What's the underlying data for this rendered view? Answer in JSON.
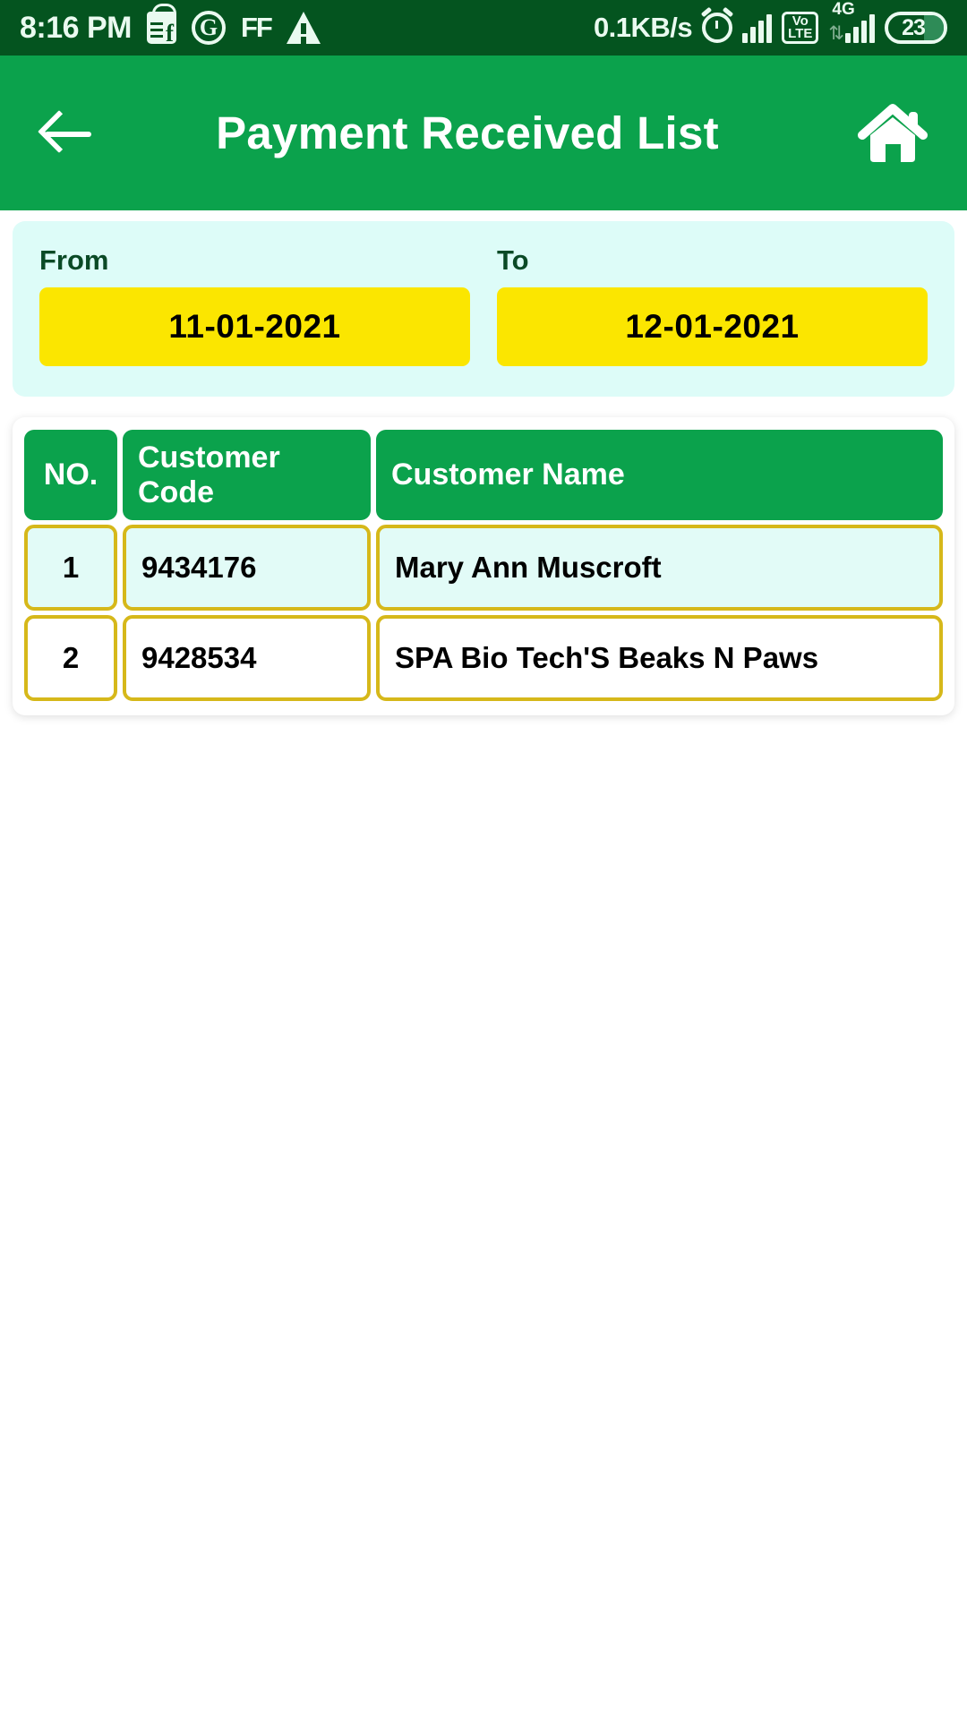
{
  "status_bar": {
    "clock": "8:16 PM",
    "network_speed": "0.1KB/s",
    "ff_label": "FF",
    "g_label": "G",
    "volte_top": "Vo",
    "volte_bottom": "LTE",
    "network_type": "4G",
    "battery_level": "23",
    "icons": [
      "facebook-marketplace-icon",
      "g-circle-icon",
      "ff-app-icon",
      "warning-triangle-icon",
      "alarm-clock-icon",
      "signal-bars-icon",
      "volte-icon",
      "sim2-signal-icon",
      "battery-icon"
    ],
    "colors": {
      "background": "#04541f",
      "foreground": "#eafaf0"
    }
  },
  "app_bar": {
    "title": "Payment Received List",
    "back_icon": "back-arrow-icon",
    "home_icon": "home-icon",
    "colors": {
      "background": "#0ba24c",
      "text": "#ffffff"
    }
  },
  "filter": {
    "from_label": "From",
    "to_label": "To",
    "from_date": "11-01-2021",
    "to_date": "12-01-2021",
    "colors": {
      "card": "#ddfcf8",
      "button": "#fbe600",
      "label": "#0a4a26"
    }
  },
  "table": {
    "headers": {
      "no": "NO.",
      "customer_code": "Customer Code",
      "customer_name": "Customer Name"
    },
    "rows": [
      {
        "no": "1",
        "customer_code": "9434176",
        "customer_name": "Mary Ann Muscroft"
      },
      {
        "no": "2",
        "customer_code": "9428534",
        "customer_name": "SPA Bio Tech'S Beaks N Paws"
      }
    ],
    "colors": {
      "header_bg": "#0ba24c",
      "header_text": "#ffffff",
      "cell_border": "#d6b81a",
      "row_alt_bg": "#e2fbf7",
      "row_bg": "#ffffff"
    }
  }
}
